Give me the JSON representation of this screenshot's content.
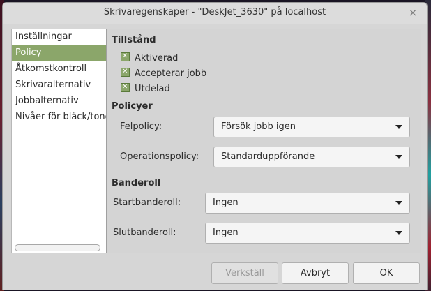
{
  "window": {
    "title": "Skrivaregenskaper - \"DeskJet_3630\" på localhost",
    "close_label": "×"
  },
  "sidebar": {
    "items": [
      {
        "label": "Inställningar",
        "active": false
      },
      {
        "label": "Policy",
        "active": true
      },
      {
        "label": "Åtkomstkontroll",
        "active": false
      },
      {
        "label": "Skrivaralternativ",
        "active": false
      },
      {
        "label": "Jobbalternativ",
        "active": false
      },
      {
        "label": "Nivåer för bläck/toner",
        "active": false
      }
    ]
  },
  "state": {
    "title": "Tillstånd",
    "checkboxes": [
      {
        "label": "Aktiverad",
        "checked": true
      },
      {
        "label": "Accepterar jobb",
        "checked": true
      },
      {
        "label": "Utdelad",
        "checked": true
      }
    ]
  },
  "policies": {
    "title": "Policyer",
    "error_policy": {
      "label": "Felpolicy:",
      "value": "Försök jobb igen"
    },
    "operation_policy": {
      "label": "Operationspolicy:",
      "value": "Standarduppförande"
    }
  },
  "banner": {
    "title": "Banderoll",
    "start": {
      "label": "Startbanderoll:",
      "value": "Ingen"
    },
    "end": {
      "label": "Slutbanderoll:",
      "value": "Ingen"
    }
  },
  "buttons": {
    "apply": "Verkställ",
    "cancel": "Avbryt",
    "ok": "OK"
  },
  "colors": {
    "accent": "#8ba66a"
  }
}
